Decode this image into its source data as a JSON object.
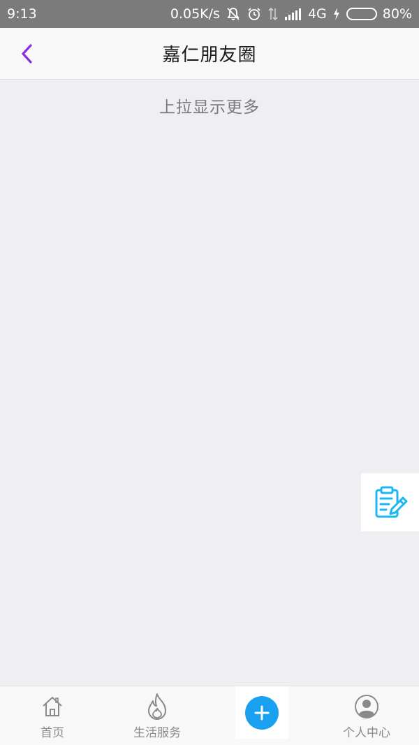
{
  "status_bar": {
    "time": "9:13",
    "net_speed": "0.05K/s",
    "network": "4G",
    "battery": "80%",
    "battery_level": 0.8,
    "icons": [
      "mute-icon",
      "alarm-icon",
      "data-transfer-icon",
      "signal-icon",
      "charging-icon",
      "battery-icon"
    ]
  },
  "header": {
    "title": "嘉仁朋友圈",
    "back_icon": "chevron-left-icon",
    "accent_color": "#8a2be2"
  },
  "content": {
    "load_more_text": "上拉显示更多",
    "edit_icon": "edit-note-icon",
    "edit_icon_color": "#1ab7f0"
  },
  "tabbar": {
    "items": [
      {
        "label": "首页",
        "icon": "home-icon"
      },
      {
        "label": "生活服务",
        "icon": "flame-icon"
      },
      {
        "label": "",
        "icon": "plus-icon"
      },
      {
        "label": "个人中心",
        "icon": "user-icon"
      }
    ],
    "add_color": "#1aa0f0"
  }
}
